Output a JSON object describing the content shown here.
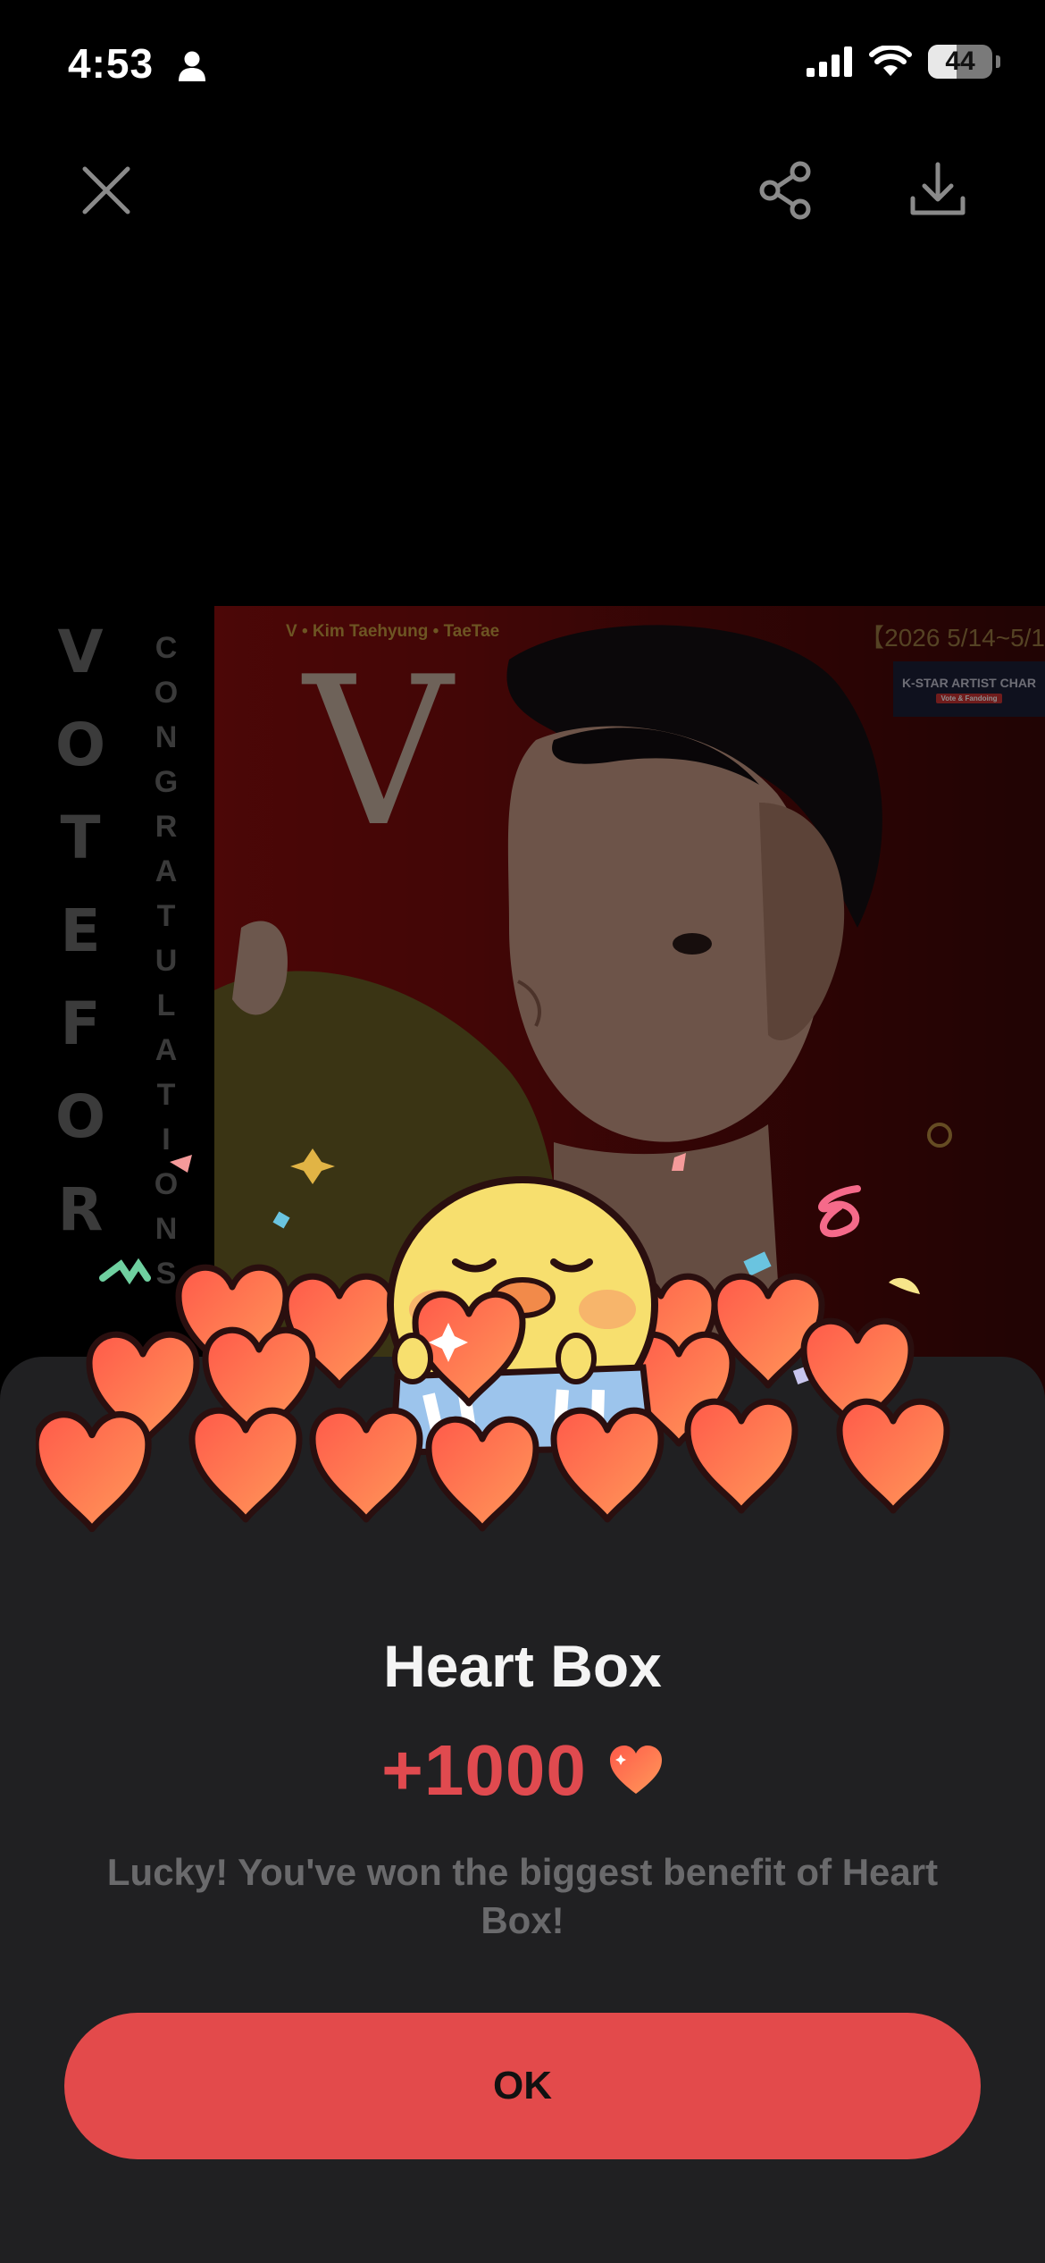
{
  "status_bar": {
    "time": "4:53",
    "battery": "44",
    "battery_level": 0.44
  },
  "artwork": {
    "vertical_left": "VOTEFOR",
    "vertical_right": "CONGRATULATIONS",
    "poster_subtitle": "V • Kim Taehyung • TaeTae",
    "poster_letter": "V",
    "poster_date": "【2026 5/14~5/1",
    "poster_badge": "K-STAR ARTIST CHAR",
    "poster_badge_sub": "Vote & Fandoing"
  },
  "dialog": {
    "title": "Heart Box",
    "reward": "+1000",
    "message": "Lucky! You've won the biggest benefit of Heart Box!",
    "ok_label": "OK"
  },
  "colors": {
    "accent": "#e34a4b",
    "sheet": "#202022"
  }
}
